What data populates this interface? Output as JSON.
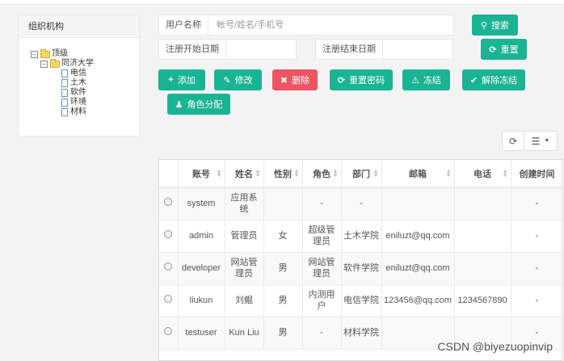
{
  "tree": {
    "title": "组织机构",
    "root": "顶级",
    "org": "同济大学",
    "depts": [
      "电信",
      "土木",
      "软件",
      "环境",
      "材料"
    ]
  },
  "search": {
    "username_label": "用户名称",
    "username_placeholder": "帐号/姓名/手机号",
    "start_label": "注册开始日期",
    "end_label": "注册结束日期",
    "search_btn": "搜索",
    "reset_btn": "重置"
  },
  "toolbar": {
    "add": "添加",
    "edit": "修改",
    "delete": "删除",
    "reset_pwd": "重置密码",
    "freeze": "冻结",
    "unfreeze": "解除冻结",
    "assign_role": "角色分配"
  },
  "table": {
    "columns": [
      "账号",
      "姓名",
      "性别",
      "角色",
      "部门",
      "邮箱",
      "电话",
      "创建时间"
    ],
    "rows": [
      [
        "system",
        "应用系统",
        "",
        "-",
        "-",
        "",
        "",
        "-"
      ],
      [
        "admin",
        "管理员",
        "女",
        "超级管理员",
        "土木学院",
        "eniluzt@qq.com",
        "",
        "-"
      ],
      [
        "developer",
        "网站管理员",
        "男",
        "网站管理员",
        "软件学院",
        "eniluzt@qq.com",
        "",
        "-"
      ],
      [
        "liukun",
        "刘鲲",
        "男",
        "内测用户",
        "电信学院",
        "123456@qq.com",
        "1234567890",
        "-"
      ],
      [
        "testuser",
        "Kun Liu",
        "男",
        "-",
        "材料学院",
        "",
        "",
        "-"
      ]
    ]
  },
  "watermark": "CSDN @biyezuopinvip"
}
